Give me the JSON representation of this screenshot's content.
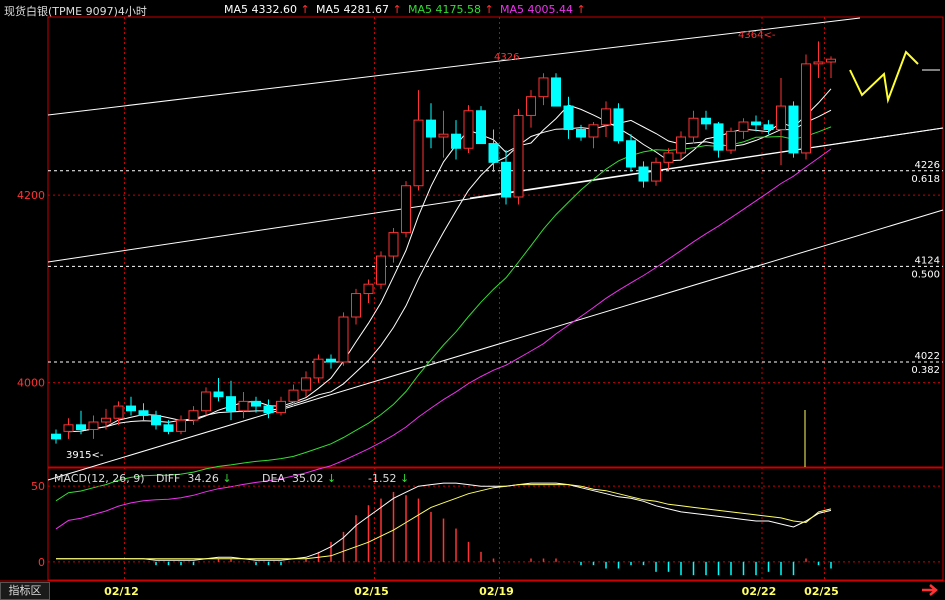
{
  "header": {
    "symbol": "现货白银(TPME 9097)4小时",
    "ma": [
      {
        "label": "MA5",
        "value": "4332.60",
        "arrow": "↑",
        "color": "#ffffff"
      },
      {
        "label": "MA5",
        "value": "4281.67",
        "arrow": "↑",
        "color": "#ffffff"
      },
      {
        "label": "MA5",
        "value": "4175.58",
        "arrow": "↑",
        "color": "#33dd33"
      },
      {
        "label": "MA5",
        "value": "4005.44",
        "arrow": "↑",
        "color": "#ee33ee"
      }
    ]
  },
  "macd_header": {
    "name": "MACD(12, 26, 9)",
    "diff_label": "DIFF",
    "diff_value": "34.26",
    "diff_arrow": "↓",
    "dea_label": "DEA",
    "dea_value": "35.02",
    "dea_arrow": "↓",
    "macd_value": "-1.52",
    "macd_arrow": "↓"
  },
  "tabs": {
    "indicator": "指标区"
  },
  "colors": {
    "up": "#ff3333",
    "down": "#00ffff",
    "axis": "#cc0000",
    "fib": "#ffffff",
    "macd_line": "#ffff66"
  },
  "chart_data": {
    "type": "candlestick",
    "y_labels": [
      "4200",
      "4000"
    ],
    "ylim": [
      3910,
      4390
    ],
    "x_labels": [
      "02/12",
      "02/15",
      "02/19",
      "02/22",
      "02/25"
    ],
    "fib_levels": [
      {
        "price": 4226,
        "label": "4226",
        "ratio": "0.618"
      },
      {
        "price": 4124,
        "label": "4124",
        "ratio": "0.500"
      },
      {
        "price": 4022,
        "label": "4022",
        "ratio": "0.382"
      }
    ],
    "annotations": {
      "high": "4364",
      "peak": "4326",
      "low": "3915"
    },
    "candles": [
      [
        3945,
        3950,
        3935,
        3940
      ],
      [
        3948,
        3962,
        3940,
        3955
      ],
      [
        3955,
        3970,
        3945,
        3950
      ],
      [
        3950,
        3965,
        3940,
        3958
      ],
      [
        3958,
        3972,
        3950,
        3962
      ],
      [
        3962,
        3980,
        3955,
        3975
      ],
      [
        3975,
        3985,
        3965,
        3970
      ],
      [
        3970,
        3978,
        3960,
        3965
      ],
      [
        3965,
        3970,
        3950,
        3955
      ],
      [
        3955,
        3960,
        3945,
        3948
      ],
      [
        3948,
        3965,
        3945,
        3960
      ],
      [
        3960,
        3975,
        3955,
        3970
      ],
      [
        3970,
        3995,
        3965,
        3990
      ],
      [
        3990,
        4005,
        3980,
        3985
      ],
      [
        3985,
        4002,
        3960,
        3970
      ],
      [
        3970,
        3990,
        3962,
        3980
      ],
      [
        3980,
        3985,
        3968,
        3975
      ],
      [
        3975,
        3982,
        3962,
        3968
      ],
      [
        3968,
        3985,
        3965,
        3980
      ],
      [
        3980,
        3998,
        3975,
        3992
      ],
      [
        3992,
        4012,
        3985,
        4005
      ],
      [
        4005,
        4030,
        4000,
        4025
      ],
      [
        4025,
        4030,
        4015,
        4022
      ],
      [
        4022,
        4075,
        4018,
        4070
      ],
      [
        4070,
        4100,
        4062,
        4095
      ],
      [
        4095,
        4110,
        4085,
        4105
      ],
      [
        4105,
        4140,
        4100,
        4135
      ],
      [
        4135,
        4165,
        4128,
        4160
      ],
      [
        4160,
        4215,
        4155,
        4210
      ],
      [
        4210,
        4312,
        4205,
        4280
      ],
      [
        4280,
        4298,
        4250,
        4262
      ],
      [
        4262,
        4290,
        4240,
        4265
      ],
      [
        4265,
        4280,
        4238,
        4250
      ],
      [
        4250,
        4296,
        4245,
        4290
      ],
      [
        4290,
        4295,
        4258,
        4255
      ],
      [
        4255,
        4270,
        4225,
        4235
      ],
      [
        4235,
        4248,
        4190,
        4198
      ],
      [
        4198,
        4292,
        4190,
        4285
      ],
      [
        4285,
        4312,
        4272,
        4305
      ],
      [
        4305,
        4330,
        4296,
        4325
      ],
      [
        4325,
        4330,
        4300,
        4295
      ],
      [
        4295,
        4305,
        4260,
        4270
      ],
      [
        4270,
        4275,
        4258,
        4262
      ],
      [
        4262,
        4278,
        4250,
        4275
      ],
      [
        4275,
        4300,
        4262,
        4292
      ],
      [
        4292,
        4298,
        4255,
        4258
      ],
      [
        4258,
        4265,
        4225,
        4230
      ],
      [
        4230,
        4236,
        4208,
        4215
      ],
      [
        4215,
        4240,
        4210,
        4235
      ],
      [
        4235,
        4250,
        4228,
        4245
      ],
      [
        4245,
        4268,
        4238,
        4262
      ],
      [
        4262,
        4290,
        4255,
        4282
      ],
      [
        4282,
        4290,
        4270,
        4276
      ],
      [
        4276,
        4278,
        4240,
        4248
      ],
      [
        4248,
        4272,
        4244,
        4268
      ],
      [
        4268,
        4282,
        4260,
        4278
      ],
      [
        4278,
        4285,
        4268,
        4275
      ],
      [
        4275,
        4280,
        4265,
        4270
      ],
      [
        4270,
        4325,
        4232,
        4295
      ],
      [
        4295,
        4300,
        4240,
        4245
      ],
      [
        4245,
        4350,
        4238,
        4340
      ],
      [
        4340,
        4364,
        4325,
        4342
      ],
      [
        4342,
        4348,
        4325,
        4345
      ]
    ],
    "macd": {
      "ylim": [
        -12,
        62
      ],
      "y_labels": [
        "50",
        "0"
      ],
      "diff": [
        2,
        2,
        2,
        2,
        2,
        2,
        2,
        2,
        1,
        1,
        1,
        1,
        2,
        3,
        3,
        2,
        1,
        1,
        1,
        2,
        3,
        6,
        10,
        16,
        24,
        30,
        36,
        42,
        46,
        50,
        51,
        52,
        52,
        51,
        50,
        50,
        50,
        51,
        52,
        52,
        52,
        51,
        49,
        47,
        45,
        43,
        42,
        40,
        37,
        35,
        33,
        32,
        31,
        30,
        29,
        28,
        27,
        27,
        25,
        23,
        27,
        32,
        34
      ],
      "dea": [
        2,
        2,
        2,
        2,
        2,
        2,
        2,
        2,
        2,
        2,
        2,
        2,
        2,
        2,
        2,
        2,
        2,
        2,
        2,
        2,
        2,
        3,
        4,
        7,
        10,
        13,
        17,
        21,
        26,
        31,
        36,
        39,
        42,
        45,
        47,
        49,
        50,
        51,
        51,
        51,
        51,
        51,
        50,
        48,
        47,
        45,
        43,
        41,
        40,
        38,
        37,
        36,
        35,
        34,
        33,
        32,
        31,
        30,
        29,
        27,
        26,
        33,
        35
      ],
      "hist": [
        0,
        0,
        0,
        0,
        0,
        0,
        0,
        0,
        -1,
        -1,
        -1,
        -1,
        0,
        1,
        1,
        0,
        -1,
        -1,
        -1,
        0,
        1,
        3,
        6,
        9,
        14,
        17,
        19,
        21,
        20,
        19,
        15,
        13,
        10,
        6,
        3,
        1,
        0,
        0,
        1,
        1,
        1,
        0,
        -1,
        -1,
        -2,
        -2,
        -1,
        -1,
        -3,
        -3,
        -4,
        -4,
        -4,
        -4,
        -4,
        -4,
        -4,
        -3,
        -4,
        -4,
        1,
        -1,
        -2
      ]
    }
  }
}
